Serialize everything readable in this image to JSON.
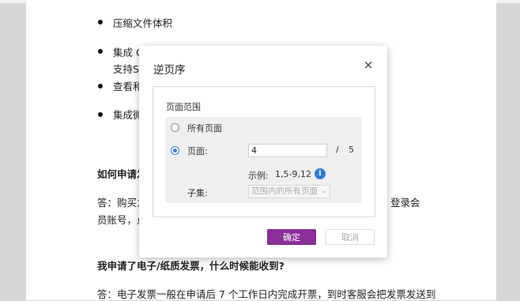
{
  "document": {
    "bullets": [
      {
        "line1": "压缩文件体积"
      },
      {
        "line1": "集成 O",
        "line2": "支持Sł"
      },
      {
        "line1": "查看和"
      },
      {
        "line1": "集成微"
      }
    ],
    "faq1_question": "如何申请发",
    "faq1_answer_line1_left": "答：购买之",
    "faq1_answer_line1_right": "登录会",
    "faq1_answer_line2": "员账号，点",
    "faq2_question": "我申请了电子/纸质发票，什么时候能收到?",
    "faq2_answer": "答：电子发票一般在申请后 7 个工作日内完成开票，到时客服会把发票发送到"
  },
  "dialog": {
    "title": "逆页序",
    "close_glyph": "×",
    "range_section_label": "页面范围",
    "all_pages_label": "所有页面",
    "pages_label": "页面:",
    "pages_value": "4",
    "total_separator": "/",
    "total_pages": "5",
    "example_label": "示例:",
    "example_value": "1,5-9,12",
    "info_glyph": "i",
    "subset_label": "子集:",
    "subset_value": "范围内的所有页面",
    "subset_chevron": "⌄",
    "ok_label": "确定",
    "cancel_label": "取消",
    "selected_option": "pages"
  },
  "colors": {
    "accent": "#8b2f99",
    "radio_selected": "#3a7bd5",
    "info": "#2f7bd8"
  }
}
